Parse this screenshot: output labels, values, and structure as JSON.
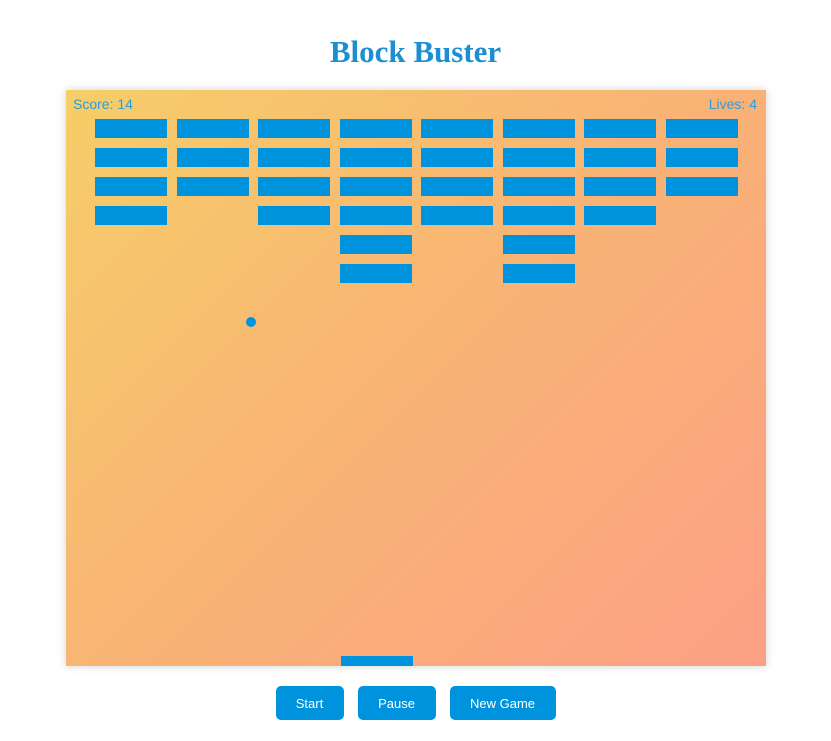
{
  "page": {
    "title": "Block Buster"
  },
  "hud": {
    "score_label": "Score: 14",
    "lives_label": "Lives: 4",
    "score": 14,
    "lives": 4
  },
  "bricks": {
    "columns": 8,
    "rows": 6,
    "present": [
      [
        1,
        1,
        1,
        1,
        1,
        1,
        1,
        1
      ],
      [
        1,
        1,
        1,
        1,
        1,
        1,
        1,
        1
      ],
      [
        1,
        1,
        1,
        1,
        1,
        1,
        1,
        1
      ],
      [
        1,
        0,
        1,
        1,
        1,
        1,
        1,
        0
      ],
      [
        0,
        0,
        0,
        1,
        0,
        1,
        0,
        0
      ],
      [
        0,
        0,
        0,
        1,
        0,
        1,
        0,
        0
      ]
    ]
  },
  "controls": {
    "start_label": "Start",
    "pause_label": "Pause",
    "new_game_label": "New Game"
  },
  "colors": {
    "accent": "#0093dd",
    "title": "#1b8fd2",
    "hud_text": "#2a9ddd",
    "board_gradient_start": "#f6ce68",
    "board_gradient_end": "#fda085"
  }
}
